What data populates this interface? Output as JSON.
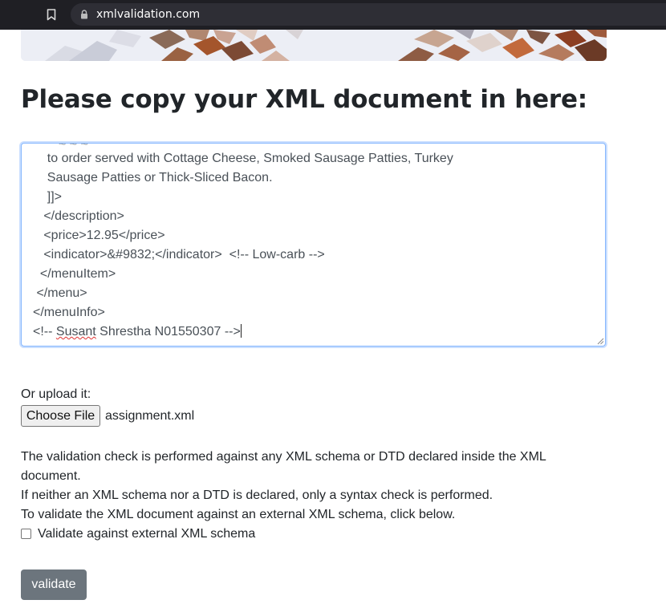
{
  "browser": {
    "url": "xmlvalidation.com"
  },
  "page": {
    "heading": "Please copy your XML document in here:",
    "xml_lines": [
      "    to order served with Cottage Cheese, Smoked Sausage Patties, Turkey",
      "    Sausage Patties or Thick-Sliced Bacon.",
      "    ]]>",
      "   </description>",
      "   <price>12.95</price>",
      "   <indicator>&#9832;</indicator>  <!-- Low-carb -->",
      "  </menuItem>",
      " </menu>",
      "</menuInfo>"
    ],
    "last_line_prefix": "<!-- ",
    "last_line_misspelled": "Susant",
    "last_line_suffix": " Shrestha N01550307 -->",
    "upload_label": "Or upload it:",
    "file_button_label": "Choose File",
    "file_name": "assignment.xml",
    "info_lines": [
      "The validation check is performed against any XML schema or DTD declared inside the XML",
      "document.",
      "If neither an XML schema nor a DTD is declared, only a syntax check is performed.",
      "To validate the XML document against an external XML schema, click below."
    ],
    "checkbox_label": "Validate against external XML schema",
    "checkbox_checked": false,
    "validate_button_label": "validate"
  },
  "colors": {
    "focus_border": "#86b7fe",
    "button_secondary": "#6c757d",
    "browser_bar": "#1f1f24"
  }
}
